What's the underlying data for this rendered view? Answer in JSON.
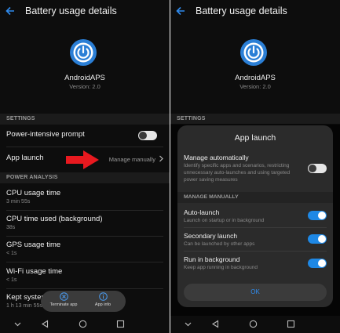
{
  "header": {
    "title": "Battery usage details"
  },
  "app": {
    "name": "AndroidAPS",
    "version": "Version: 2.0"
  },
  "settings": {
    "section_label": "SETTINGS",
    "power_intensive_label": "Power-intensive prompt",
    "power_intensive_on": false,
    "app_launch_label": "App launch",
    "app_launch_value": "Manage manually"
  },
  "power_analysis": {
    "section_label": "POWER ANALYSIS",
    "items": [
      {
        "title": "CPU usage time",
        "value": "3 min 55s"
      },
      {
        "title": "CPU time used (background)",
        "value": "38s"
      },
      {
        "title": "GPS usage time",
        "value": "< 1s"
      },
      {
        "title": "Wi-Fi usage time",
        "value": "< 1s"
      },
      {
        "title": "Kept system awake",
        "value": "1 h 13 min 55s"
      }
    ]
  },
  "pill": {
    "terminate_label": "Terminate app",
    "info_label": "App info"
  },
  "dialog": {
    "title": "App launch",
    "manage_auto_title": "Manage automatically",
    "manage_auto_sub": "Identify specific apps and scenarios, restricting unnecessary auto-launches and using targeted power saving measures",
    "manage_auto_on": false,
    "section_label": "MANAGE MANUALLY",
    "options": [
      {
        "title": "Auto-launch",
        "sub": "Launch on startup or in background",
        "on": true
      },
      {
        "title": "Secondary launch",
        "sub": "Can be launched by other apps",
        "on": true
      },
      {
        "title": "Run in background",
        "sub": "Keep app running in background",
        "on": true
      }
    ],
    "ok_label": "OK"
  },
  "colors": {
    "accent": "#1e88e5",
    "annotation_arrow": "#e8191f",
    "background": "#0d0d0d"
  },
  "icons": [
    "back-arrow-icon",
    "app-power-icon",
    "chevron-right-icon",
    "terminate-icon",
    "info-icon",
    "nav-hide-icon",
    "nav-back-icon",
    "nav-home-icon",
    "nav-recents-icon"
  ]
}
